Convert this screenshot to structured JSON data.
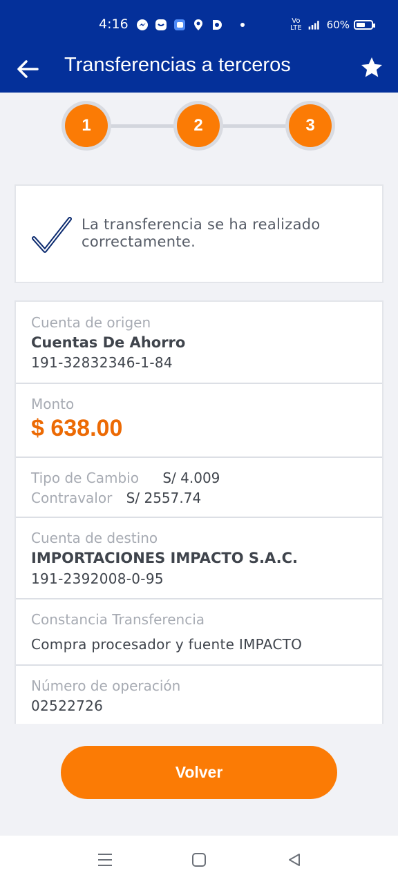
{
  "status_bar": {
    "time": "4:16",
    "network_top": "Vo",
    "network_bottom": "LTE",
    "signal_label": "4G",
    "battery_percent": "60%",
    "battery_level": 0.6,
    "icons": [
      "messenger-icon",
      "chat-bubble-icon",
      "app-square-icon",
      "location-icon",
      "d-app-icon",
      "dot-icon",
      "signal-icon",
      "battery-icon"
    ]
  },
  "app_bar": {
    "title": "Transferencias a terceros",
    "back_icon": "arrow-left-icon",
    "favorite_icon": "star-icon"
  },
  "stepper": {
    "steps": [
      "1",
      "2",
      "3"
    ],
    "active_color": "#fb7b05"
  },
  "success": {
    "message": "La transferencia se ha realizado correctamente.",
    "line1": "La transferencia se ha realizado",
    "line2": "correctamente."
  },
  "details": {
    "origin": {
      "label": "Cuenta de origen",
      "name": "Cuentas De Ahorro",
      "number": "191-32832346-1-84"
    },
    "amount": {
      "label": "Monto",
      "value": "$ 638.00"
    },
    "exchange": {
      "rate_label": "Tipo de Cambio",
      "rate_value": "S/ 4.009",
      "counter_label": "Contravalor",
      "counter_value": "S/ 2557.74"
    },
    "destination": {
      "label": "Cuenta de destino",
      "name": "IMPORTACIONES IMPACTO S.A.C.",
      "number": "191-2392008-0-95"
    },
    "receipt": {
      "label": "Constancia Transferencia",
      "value": "Compra procesador y fuente IMPACTO"
    },
    "operation": {
      "label": "Número de operación",
      "value": "02522726"
    }
  },
  "actions": {
    "back_button": "Volver"
  },
  "colors": {
    "brand_blue": "#04309a",
    "accent_orange": "#fb7b05",
    "amount_orange": "#ec6a04"
  }
}
